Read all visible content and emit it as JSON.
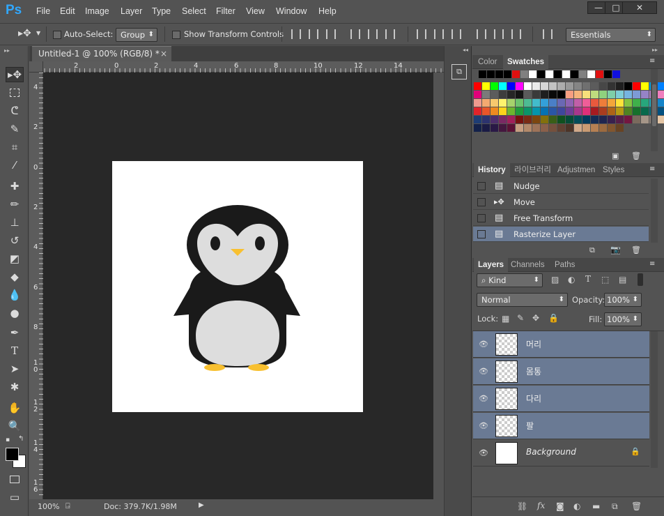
{
  "app": {
    "logo": "Ps"
  },
  "menu": [
    "File",
    "Edit",
    "Image",
    "Layer",
    "Type",
    "Select",
    "Filter",
    "View",
    "Window",
    "Help"
  ],
  "window_controls": {
    "minimize": "—",
    "maximize": "□",
    "close": "✕"
  },
  "options": {
    "auto_select_label": "Auto-Select:",
    "auto_select_value": "Group",
    "show_transform_label": "Show Transform Controls",
    "workspace": "Essentials"
  },
  "document": {
    "tab_title": "Untitled-1 @ 100% (RGB/8) *",
    "close": "×",
    "zoom": "100%",
    "doc_info": "Doc: 379.7K/1.98M"
  },
  "rulers": {
    "h": [
      "2",
      "0",
      "2",
      "4",
      "6",
      "8",
      "10",
      "12",
      "14"
    ],
    "v": [
      "4",
      "2",
      "0",
      "2",
      "4",
      "6",
      "8",
      "1\n0",
      "1\n2",
      "1\n4",
      "1\n6"
    ]
  },
  "color_panel": {
    "tabs": [
      "Color",
      "Swatches"
    ],
    "active": "Swatches"
  },
  "swatches": {
    "row0": [
      "#000",
      "#000",
      "#000",
      "#000",
      "#e01010",
      "#808080",
      "#fff",
      "#000",
      "#fff",
      "#000",
      "#fff",
      "#000",
      "#808080",
      "#fff",
      "#e01010",
      "#000",
      "#1010e0"
    ],
    "rows": [
      [
        "#ff0000",
        "#ffff00",
        "#00ff00",
        "#00ffff",
        "#0000ff",
        "#ff00ff",
        "#ffffff",
        "#ebebeb",
        "#d6d6d6",
        "#c2c2c2",
        "#adadad",
        "#999",
        "#858585",
        "#707070",
        "#5c5c5c",
        "#474747",
        "#333",
        "#1f1f1f",
        "#000",
        "#ff0000",
        "#ffff00",
        "#00a0e0",
        "#0080ff"
      ],
      [
        "#e0007a",
        "#7a7a7a",
        "#5c5c5c",
        "#3d3d3d",
        "#262626",
        "#141414",
        "#5a5a5a",
        "#3a3a3a",
        "#1e1e1e",
        "#0a0a0a",
        "#000000",
        "#f79f81",
        "#f6b57b",
        "#f8e07b",
        "#bfdc7e",
        "#8fd17e",
        "#7ecfa8",
        "#7ecdd6",
        "#76b4e0",
        "#7d9bd6",
        "#9683c6",
        "#b681c5",
        "#f07fbe"
      ],
      [
        "#ef9a8f",
        "#f4a971",
        "#f7c96e",
        "#fef36e",
        "#a6d26c",
        "#6cc36e",
        "#4dbb93",
        "#42bccc",
        "#34a0d9",
        "#4a7fc7",
        "#6a68b4",
        "#8e63b2",
        "#c15fa8",
        "#ef5e98",
        "#e9593d",
        "#ee7d3a",
        "#f3a63a",
        "#fde33a",
        "#85c341",
        "#3fb04a",
        "#27a77c",
        "#1eaac0",
        "#1585ca"
      ],
      [
        "#e1242b",
        "#e8552a",
        "#ef8a1f",
        "#fcd41b",
        "#6db62f",
        "#1f9b3b",
        "#0a9469",
        "#0595ac",
        "#0672b3",
        "#2a56a4",
        "#3f479c",
        "#6d3f97",
        "#a7378d",
        "#e02f79",
        "#a61b20",
        "#a93c1f",
        "#ad6317",
        "#b69a13",
        "#4f8322",
        "#16702b",
        "#07694b",
        "#036a7b",
        "#045180"
      ],
      [
        "#1e3d75",
        "#2c336f",
        "#4e2e6b",
        "#792963",
        "#a1205a",
        "#76120f",
        "#7a2b14",
        "#7c460f",
        "#83700c",
        "#395e17",
        "#0f501f",
        "#054b36",
        "#034c59",
        "#033a5c",
        "#142c54",
        "#20254f",
        "#38214d",
        "#571e48",
        "#741640",
        "#7a6a5d",
        "#a59688",
        "#8b8178",
        "#e5c6a5"
      ],
      [
        "#13214a",
        "#1a1b45",
        "#2a1946",
        "#44173f",
        "#5b1135",
        "#c79f82",
        "#b3896a",
        "#9e7359",
        "#8a604a",
        "#75503d",
        "#604132",
        "#4c3427",
        "#d0a98a",
        "#c99b73",
        "#b58053",
        "#9c6a3f",
        "#82562f",
        "#684323"
      ]
    ]
  },
  "history_panel": {
    "tabs": [
      "History",
      "라이브러리",
      "Adjustmen",
      "Styles"
    ],
    "items": [
      "Nudge",
      "Move",
      "Free Transform",
      "Rasterize Layer"
    ]
  },
  "layers_panel": {
    "tabs": [
      "Layers",
      "Channels",
      "Paths"
    ],
    "kind_label": "Kind",
    "blend_mode": "Normal",
    "opacity_label": "Opacity:",
    "opacity": "100%",
    "lock_label": "Lock:",
    "fill_label": "Fill:",
    "fill": "100%",
    "layers": [
      {
        "name": "머리",
        "selected": true
      },
      {
        "name": "몸통",
        "selected": true
      },
      {
        "name": "다리",
        "selected": true
      },
      {
        "name": "팔",
        "selected": true
      },
      {
        "name": "Background",
        "selected": false
      }
    ]
  },
  "colors": {
    "accent": "#31a8ff",
    "selected_row": "#6a7a94",
    "canvas_bg": "#282828"
  }
}
